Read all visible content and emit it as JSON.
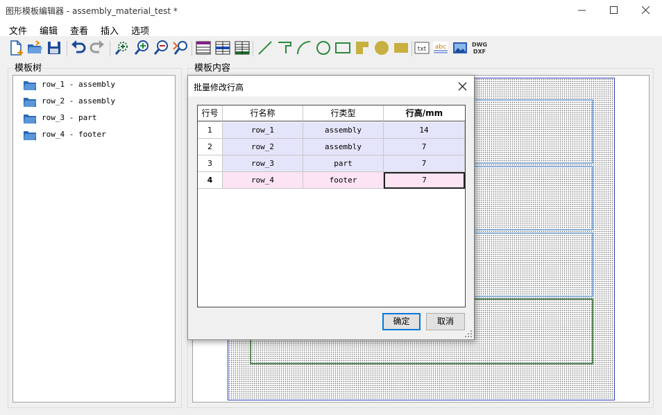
{
  "window": {
    "title": "图形模板编辑器 - assembly_material_test *"
  },
  "menu": [
    "文件",
    "编辑",
    "查看",
    "插入",
    "选项"
  ],
  "toolbar_icons": [
    "new-file-icon",
    "open-folder-icon",
    "save-icon",
    "undo-icon",
    "redo-icon",
    "zoom-fit-icon",
    "zoom-in-icon",
    "zoom-out-icon",
    "zoom-reset-icon",
    "table-purple-icon",
    "table-blue-icon",
    "table-green-icon",
    "line-icon",
    "polyline-icon",
    "arc-icon",
    "circle-icon",
    "rectangle-icon",
    "filled-polygon-icon",
    "filled-circle-icon",
    "filled-rectangle-icon",
    "text-icon",
    "text-style-icon",
    "image-icon",
    "dwg-dxf-icon"
  ],
  "toolbar_text": {
    "txt": "txt",
    "abc": "abc",
    "dwg": "DWG",
    "dxf": "DXF"
  },
  "tree": {
    "label": "模板树",
    "items": [
      "row_1 - assembly",
      "row_2 - assembly",
      "row_3 - part",
      "row_4 - footer"
    ]
  },
  "content": {
    "label": "模板内容"
  },
  "dialog": {
    "title": "批量修改行高",
    "headers": {
      "index": "行号",
      "name": "行名称",
      "type": "行类型",
      "height": "行高/mm"
    },
    "rows": [
      {
        "index": "1",
        "name": "row_1",
        "type": "assembly",
        "height": "14"
      },
      {
        "index": "2",
        "name": "row_2",
        "type": "assembly",
        "height": "7"
      },
      {
        "index": "3",
        "name": "row_3",
        "type": "part",
        "height": "7"
      },
      {
        "index": "4",
        "name": "row_4",
        "type": "footer",
        "height": "7"
      }
    ],
    "ok": "确定",
    "cancel": "取消"
  },
  "colors": {
    "assembly_row_bg": "#e4e4fa",
    "footer_row_bg": "#fce4f4",
    "sheet_border": "#3040c0",
    "default_button_border": "#0078d7"
  }
}
